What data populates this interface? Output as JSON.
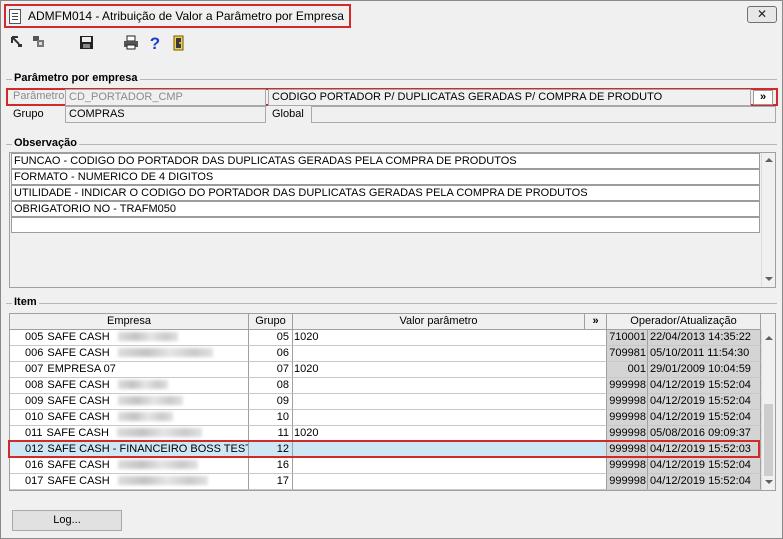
{
  "window": {
    "title": "ADMFM014 - Atribuição de Valor a Parâmetro por Empresa",
    "close_label": "✕"
  },
  "toolbar": {
    "first_icon": "first-record-icon",
    "prev_icon": "previous-record-icon",
    "save_icon": "save-icon",
    "print_icon": "print-icon",
    "help_icon": "help-icon",
    "exit_icon": "exit-icon",
    "help_glyph": "?"
  },
  "parametro_section": {
    "title": "Parâmetro por empresa",
    "parametro_label": "Parâmetro",
    "parametro_code": "CD_PORTADOR_CMP",
    "parametro_desc": "CODIGO PORTADOR P/ DUPLICATAS GERADAS P/ COMPRA DE PRODUTO",
    "lookup_label": "»",
    "grupo_label": "Grupo",
    "grupo_value": "COMPRAS",
    "global_label": "Global",
    "global_value": ""
  },
  "observacao_section": {
    "title": "Observação",
    "lines": [
      "FUNCAO - CODIGO DO PORTADOR DAS DUPLICATAS GERADAS PELA COMPRA DE PRODUTOS",
      "FORMATO - NUMERICO DE 4 DIGITOS",
      "UTILIDADE - INDICAR O CODIGO DO PORTADOR DAS DUPLICATAS GERADAS PELA COMPRA DE PRODUTOS",
      "OBRIGATORIO NO - TRAFM050",
      ""
    ]
  },
  "item_section": {
    "title": "Item",
    "columns": {
      "empresa": "Empresa",
      "grupo": "Grupo",
      "valor": "Valor parâmetro",
      "valor_btn": "»",
      "operador": "Operador/Atualização"
    },
    "rows": [
      {
        "code": "005",
        "name": "SAFE CASH",
        "grupo": "05",
        "valor": "1020",
        "operador": "710001",
        "data": "22/04/2013 14:35:22"
      },
      {
        "code": "006",
        "name": "SAFE CASH",
        "grupo": "06",
        "valor": "",
        "operador": "709981",
        "data": "05/10/2011 11:54:30"
      },
      {
        "code": "007",
        "name": "EMPRESA 07",
        "grupo": "07",
        "valor": "1020",
        "operador": "001",
        "data": "29/01/2009 10:04:59"
      },
      {
        "code": "008",
        "name": "SAFE CASH",
        "grupo": "08",
        "valor": "",
        "operador": "999998",
        "data": "04/12/2019 15:52:04"
      },
      {
        "code": "009",
        "name": "SAFE CASH",
        "grupo": "09",
        "valor": "",
        "operador": "999998",
        "data": "04/12/2019 15:52:04"
      },
      {
        "code": "010",
        "name": "SAFE CASH",
        "grupo": "10",
        "valor": "",
        "operador": "999998",
        "data": "04/12/2019 15:52:04"
      },
      {
        "code": "011",
        "name": "SAFE CASH",
        "grupo": "11",
        "valor": "1020",
        "operador": "999998",
        "data": "05/08/2016 09:09:37"
      },
      {
        "code": "012",
        "name": "SAFE CASH - FINANCEIRO BOSS TESTE",
        "grupo": "12",
        "valor": "",
        "operador": "999998",
        "data": "04/12/2019 15:52:03"
      },
      {
        "code": "016",
        "name": "SAFE CASH",
        "grupo": "16",
        "valor": "",
        "operador": "999998",
        "data": "04/12/2019 15:52:04"
      },
      {
        "code": "017",
        "name": "SAFE CASH",
        "grupo": "17",
        "valor": "",
        "operador": "999998",
        "data": "04/12/2019 15:52:04"
      }
    ],
    "selected_row": 7
  },
  "log_button": "Log..."
}
